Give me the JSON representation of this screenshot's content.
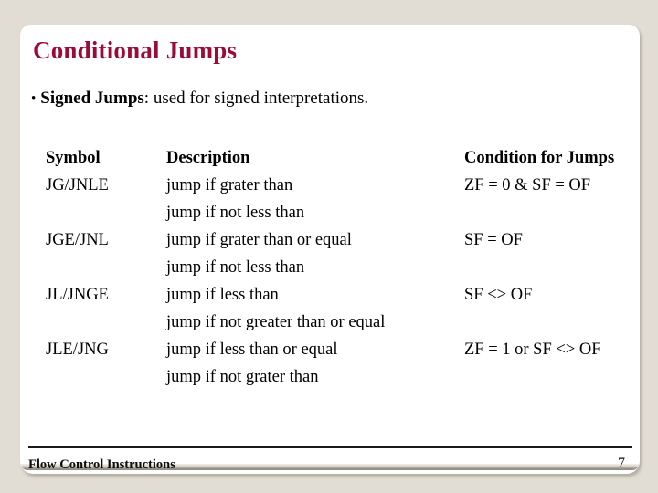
{
  "slide": {
    "title": "Conditional Jumps",
    "background_color": "#e2ddd4",
    "card_color": "#ffffff",
    "title_color": "#9c0b35"
  },
  "bullet": {
    "marker": "•",
    "lead": "Signed Jumps",
    "rest": ": used for signed interpretations."
  },
  "table": {
    "headers": {
      "symbol": "Symbol",
      "description": "Description",
      "condition": "Condition for Jumps"
    },
    "rows": [
      {
        "symbol": "JG/JNLE",
        "description": "jump if grater than",
        "condition": "ZF = 0 & SF = OF"
      },
      {
        "symbol": "",
        "description": "jump if not less than",
        "condition": ""
      },
      {
        "symbol": "JGE/JNL",
        "description": "jump if grater than or equal",
        "condition": "SF = OF"
      },
      {
        "symbol": "",
        "description": "jump if not less than",
        "condition": ""
      },
      {
        "symbol": "JL/JNGE",
        "description": "jump if less than",
        "condition": "SF <> OF"
      },
      {
        "symbol": "",
        "description": "jump if not greater than or equal",
        "condition": ""
      },
      {
        "symbol": "JLE/JNG",
        "description": "jump if less than or equal",
        "condition": "ZF = 1 or SF <> OF"
      },
      {
        "symbol": "",
        "description": "jump if not grater than",
        "condition": ""
      }
    ]
  },
  "footer": {
    "label": "Flow Control Instructions",
    "page_number": "7"
  }
}
